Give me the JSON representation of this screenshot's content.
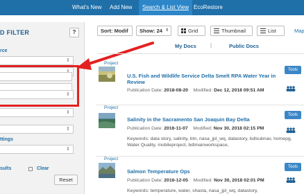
{
  "nav": {
    "tabs": [
      {
        "label": "What's New"
      },
      {
        "label": "Add New"
      },
      {
        "label": "Search & List View"
      },
      {
        "label": "EcoRestore"
      }
    ],
    "active_tab": "Search & List View",
    "bar_color": "#1f6fa9"
  },
  "sidebar": {
    "title": "D FILTER",
    "help": "?",
    "source_label": "rce",
    "settings_label": "ttings",
    "results_label": "sults",
    "clear_label": "Clear",
    "reset_label": "Reset"
  },
  "toolbar": {
    "sort_label": "Sort: Modif",
    "show_label": "Show: 24",
    "grid_label": "Grid",
    "thumbnail_label": "Thumbnail",
    "list_label": "List",
    "map_label": "Map"
  },
  "doc_tabs": {
    "my_docs": "My Docs",
    "public_docs": "Public Docs"
  },
  "annotation": {
    "highlight_color": "#e32020",
    "arrow_icon": "red-arrow-icon"
  },
  "results": [
    {
      "type": "Project",
      "title": "U.S. Fish and Wildlife Service Delta Smelt RPA Water Year in Review",
      "pub_label": "Publication Date:",
      "pub_date": "2018-08-20",
      "mod_label": "Modified:",
      "mod_date": "Dec 12, 2018 09:51 AM",
      "keywords": "",
      "tools_label": "Tools"
    },
    {
      "type": "Project",
      "title": "Salinity in the Sacramento San Joaquin Bay Delta",
      "pub_label": "Publication Date:",
      "pub_date": "2016-11-07",
      "mod_label": "Modified:",
      "mod_date": "Nov 30, 2018 02:15 PM",
      "keywords": "Keywords: data story, salinity, btn, nasa_jpl_wq, datastory, bdlsubnav, homepg, Water Quality, mobileproject, bdlmainworkspace,",
      "tools_label": "Tools"
    },
    {
      "type": "Project",
      "title": "Salmon Temperature Ops",
      "pub_label": "Publication Date:",
      "pub_date": "2016-12-05",
      "mod_label": "Modified:",
      "mod_date": "Nov 30, 2018 02:01 PM",
      "keywords": "Keywords: temperature, water, shasta, nasa_jpl_wq, datastory,",
      "tools_label": "Tools"
    }
  ]
}
